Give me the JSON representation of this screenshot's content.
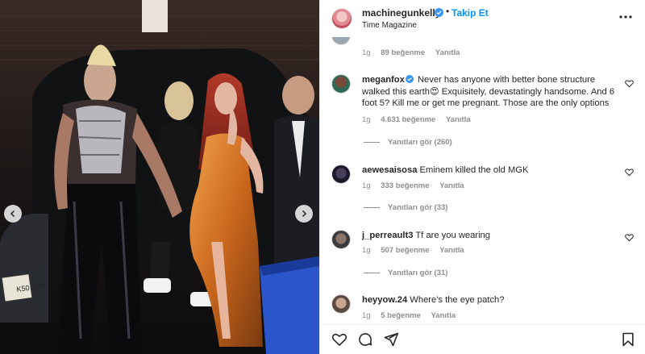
{
  "post": {
    "username": "machinegunkelly",
    "separator": "•",
    "follow_label": "Takip Et",
    "subtitle": "Time Magazine",
    "icons": {
      "more": "more-horizontal-icon",
      "verified": "verified-badge-icon"
    }
  },
  "media": {
    "plate_text": "K50 J5R",
    "icons": {
      "prev": "chevron-left-icon",
      "next": "chevron-right-icon"
    }
  },
  "comments": [
    {
      "partial": true,
      "time": "1g",
      "likes": "89 beğenme",
      "reply_label": "Yanıtla"
    },
    {
      "username": "meganfox",
      "verified": true,
      "text_before_emoji": "Never has anyone with better bone structure walked this earth",
      "emoji": "😍",
      "text_after_emoji": " Exquisitely, devastatingly handsome. And 6 foot 5? Kill me or get me pregnant. Those are the only options",
      "time": "1g",
      "likes": "4.631 beğenme",
      "reply_label": "Yanıtla",
      "view_replies": "Yanıtları gör (260)"
    },
    {
      "username": "aewesaisosa",
      "text": "Eminem killed the old MGK",
      "time": "1g",
      "likes": "333 beğenme",
      "reply_label": "Yanıtla",
      "view_replies": "Yanıtları gör (33)"
    },
    {
      "username": "j_perreault3",
      "text": "Tf are you wearing",
      "time": "1g",
      "likes": "507 beğenme",
      "reply_label": "Yanıtla",
      "view_replies": "Yanıtları gör (31)"
    },
    {
      "username": "heyyow.24",
      "text": "Where's the eye patch?",
      "time": "1g",
      "likes": "5 beğenme",
      "reply_label": "Yanıtla"
    }
  ],
  "actions": {
    "icons": [
      "heart-icon",
      "comment-icon",
      "share-icon",
      "bookmark-icon"
    ]
  },
  "colors": {
    "accent": "#0095f6",
    "text": "#262626",
    "muted": "#8e8e8e",
    "border": "#efefef"
  }
}
